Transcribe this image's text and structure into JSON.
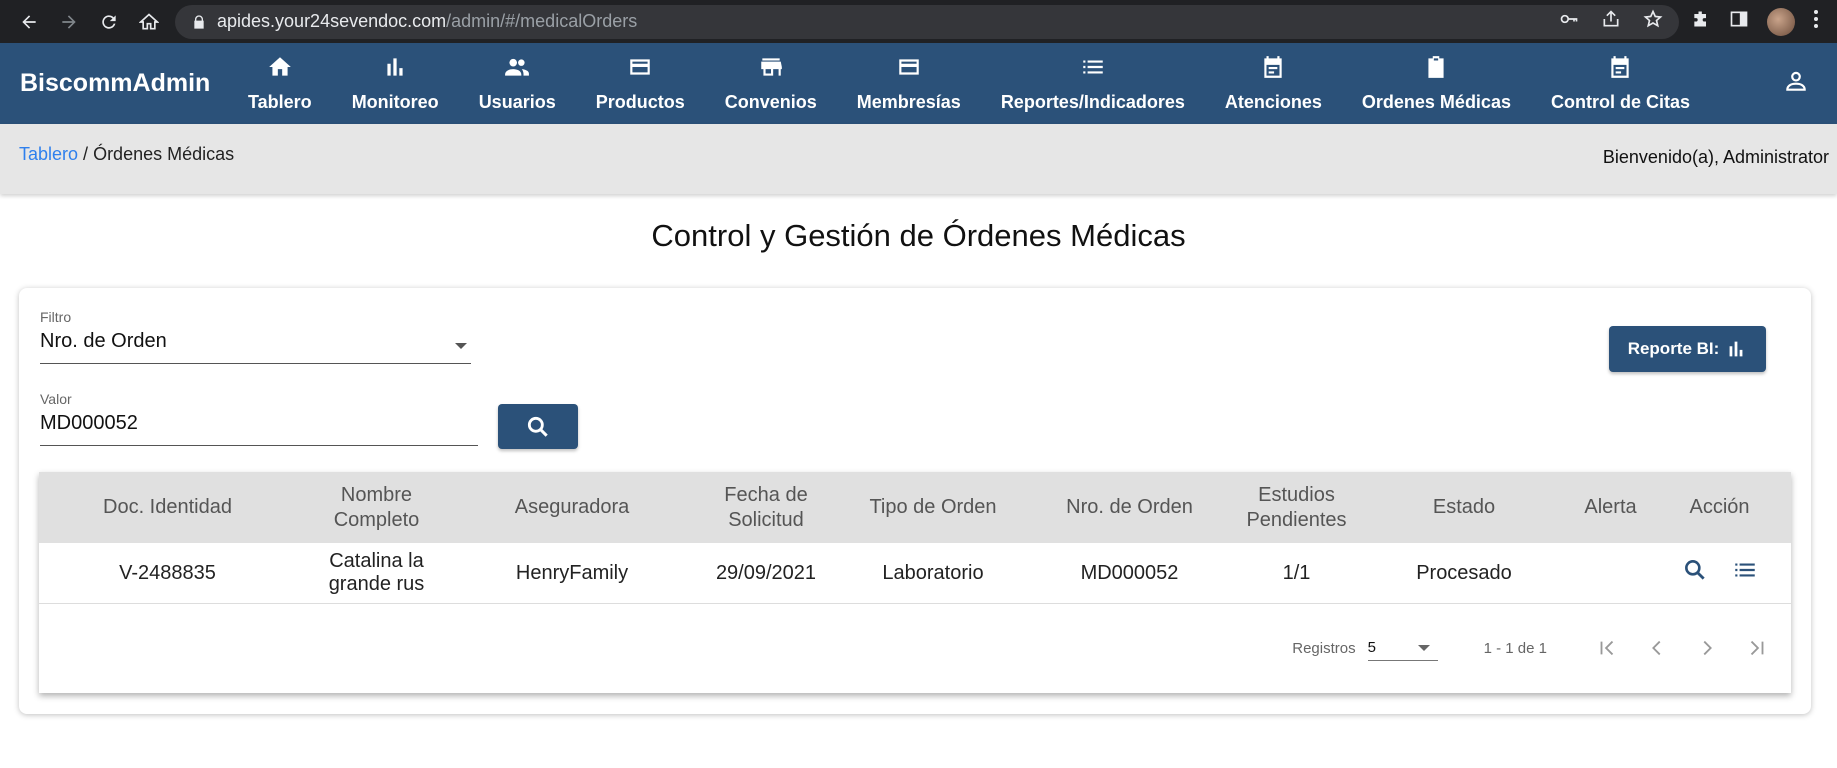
{
  "browser": {
    "url_host": "apides.your24sevendoc.com",
    "url_path": "/admin/#/medicalOrders"
  },
  "app": {
    "brand": "BiscommAdmin",
    "nav": [
      {
        "label": "Tablero",
        "icon": "home-icon"
      },
      {
        "label": "Monitoreo",
        "icon": "bar-chart-icon"
      },
      {
        "label": "Usuarios",
        "icon": "people-icon"
      },
      {
        "label": "Productos",
        "icon": "card-icon"
      },
      {
        "label": "Convenios",
        "icon": "store-icon"
      },
      {
        "label": "Membresías",
        "icon": "card-icon"
      },
      {
        "label": "Reportes/Indicadores",
        "icon": "list-icon"
      },
      {
        "label": "Atenciones",
        "icon": "event-note-icon"
      },
      {
        "label": "Ordenes Médicas",
        "icon": "clipboard-icon"
      },
      {
        "label": "Control de Citas",
        "icon": "event-note-icon"
      }
    ]
  },
  "breadcrumb": {
    "root": "Tablero",
    "separator": " / ",
    "current": "Órdenes Médicas"
  },
  "welcome": "Bienvenido(a), Administrator",
  "page_title": "Control y Gestión de Órdenes Médicas",
  "filters": {
    "filter_label": "Filtro",
    "filter_value": "Nro. de Orden",
    "value_label": "Valor",
    "value_value": "MD000052"
  },
  "report_button": "Reporte BI:",
  "table": {
    "headers": [
      "Doc. Identidad",
      "Nombre Completo",
      "Aseguradora",
      "Fecha de Solicitud",
      "Tipo de Orden",
      "Nro. de Orden",
      "Estudios Pendientes",
      "Estado",
      "Alerta",
      "Acción"
    ],
    "rows": [
      [
        "V-2488835",
        "Catalina la grande rus",
        "HenryFamily",
        "29/09/2021",
        "Laboratorio",
        "MD000052",
        "1/1",
        "Procesado",
        ""
      ]
    ]
  },
  "paginator": {
    "label": "Registros",
    "page_size": "5",
    "range": "1 - 1 de 1"
  },
  "colors": {
    "primary": "#2b5179",
    "link": "#2f80ed"
  }
}
